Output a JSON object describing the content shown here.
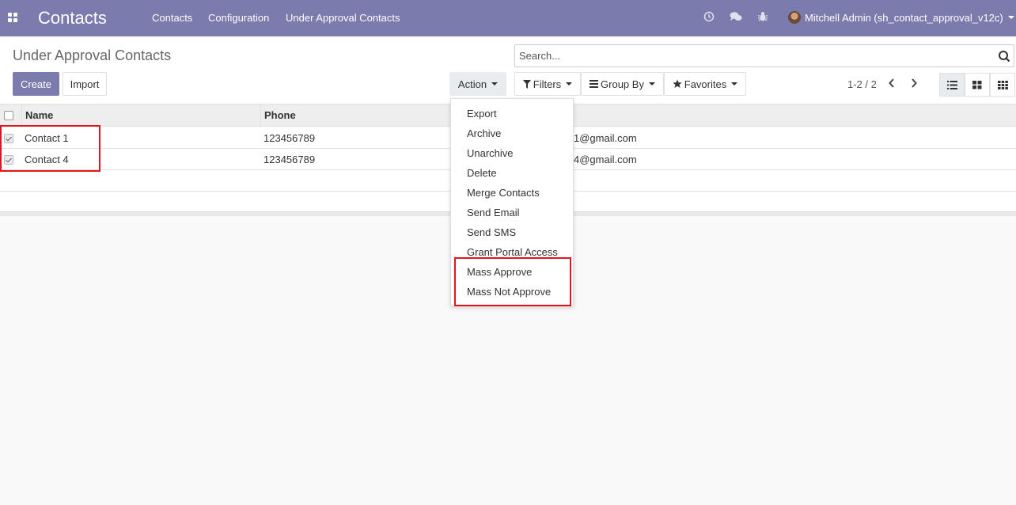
{
  "navbar": {
    "brand": "Contacts",
    "menu": [
      "Contacts",
      "Configuration",
      "Under Approval Contacts"
    ],
    "user": "Mitchell Admin (sh_contact_approval_v12c)",
    "color": "#7c7bad"
  },
  "control_panel": {
    "breadcrumb": "Under Approval Contacts",
    "create_label": "Create",
    "import_label": "Import",
    "action_label": "Action",
    "search_placeholder": "Search...",
    "filters_label": "Filters",
    "group_by_label": "Group By",
    "favorites_label": "Favorites",
    "pager": "1-2 / 2"
  },
  "table": {
    "columns": [
      "Name",
      "Phone"
    ],
    "rows": [
      {
        "name": "Contact 1",
        "phone": "123456789",
        "email_visible": "1@gmail.com",
        "checked": true
      },
      {
        "name": "Contact 4",
        "phone": "123456789",
        "email_visible": "4@gmail.com",
        "checked": true
      }
    ]
  },
  "action_menu": {
    "items": [
      "Export",
      "Archive",
      "Unarchive",
      "Delete",
      "Merge Contacts",
      "Send Email",
      "Send SMS",
      "Grant Portal Access",
      "Mass Approve",
      "Mass Not Approve"
    ]
  },
  "icons": {
    "apps": "apps-grid-icon",
    "clock": "clock-icon",
    "chat": "chat-icon",
    "bug": "bug-icon",
    "search": "search-icon",
    "filter": "filter-icon",
    "group": "bars-icon",
    "star": "star-icon",
    "list_view": "list-view-icon",
    "kanban_view": "kanban-view-icon",
    "grid_view": "grid-view-icon"
  },
  "highlight_color": "#e3141c"
}
